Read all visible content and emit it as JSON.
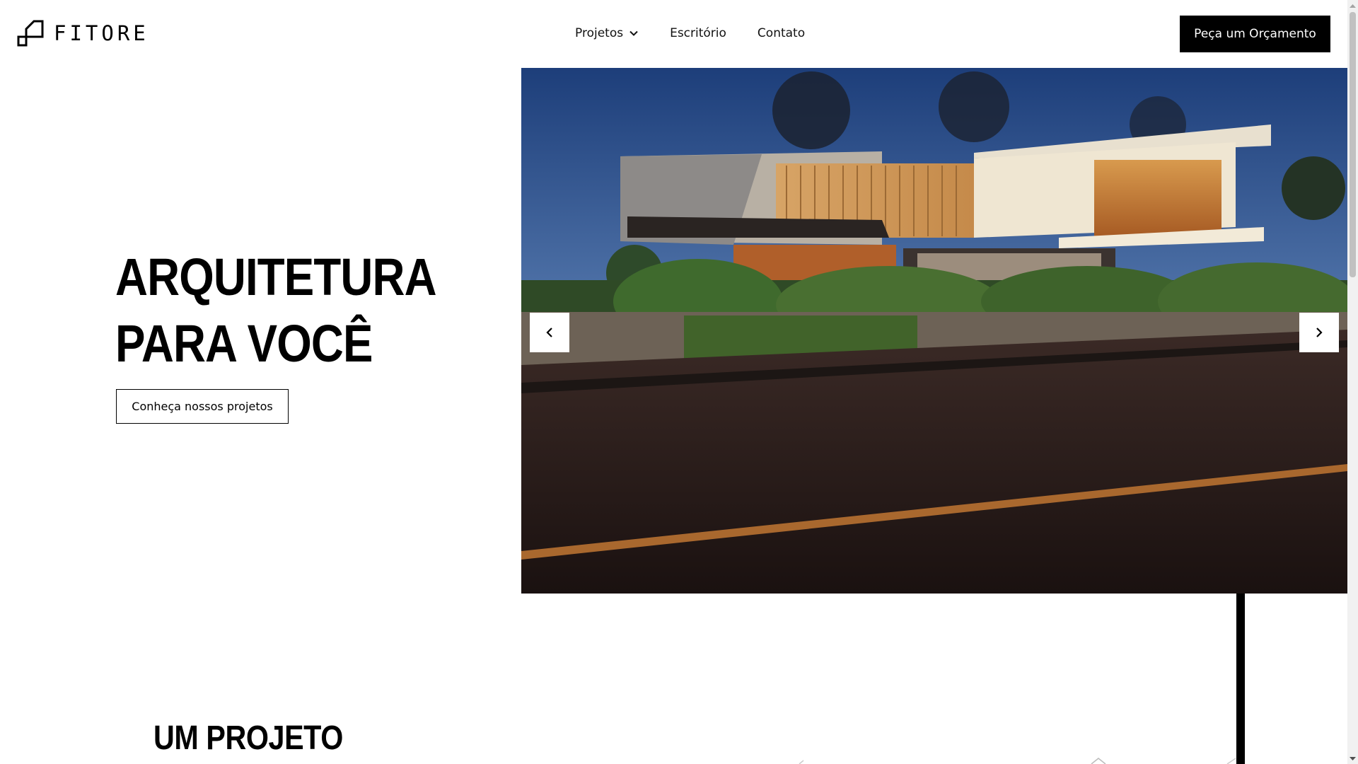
{
  "brand": {
    "name": "FITORE",
    "logo_icon": "stair-square-icon"
  },
  "nav": {
    "items": [
      {
        "label": "Projetos",
        "has_dropdown": true
      },
      {
        "label": "Escritório",
        "has_dropdown": false
      },
      {
        "label": "Contato",
        "has_dropdown": false
      }
    ]
  },
  "header": {
    "cta_label": "Peça um Orçamento"
  },
  "hero": {
    "title_line1": "ARQUITETURA",
    "title_line2": "PARA VOCÊ",
    "button_label": "Conheça nossos projetos",
    "carousel": {
      "prev_icon": "chevron-left-icon",
      "next_icon": "chevron-right-icon"
    }
  },
  "section": {
    "title": "UM PROJETO"
  },
  "colors": {
    "primary": "#000000",
    "background": "#ffffff",
    "button_text": "#ffffff"
  }
}
